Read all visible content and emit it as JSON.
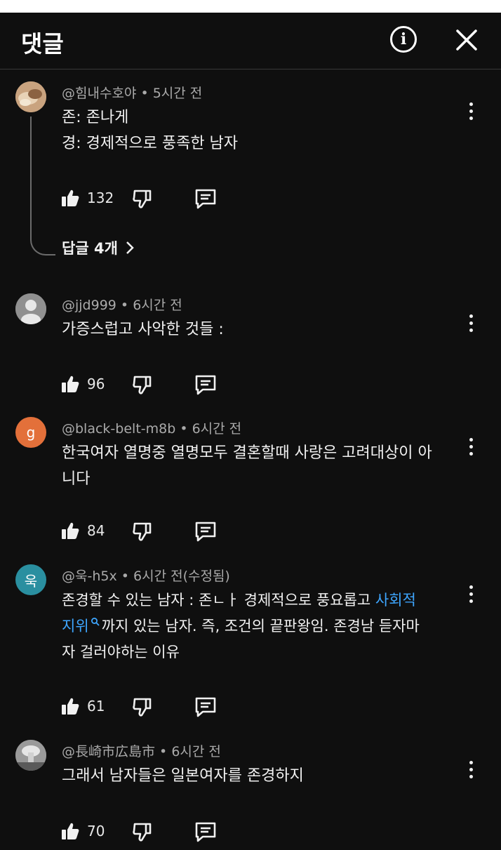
{
  "header": {
    "title": "댓글",
    "info_icon": "info-icon",
    "close_icon": "close-icon"
  },
  "comments": [
    {
      "author": "@힘내수호야",
      "time": "5시간 전",
      "avatar": {
        "type": "photo",
        "color": "#b99572"
      },
      "lines": [
        "존: 존나게",
        "경: 경제적으로 풍족한 남자"
      ],
      "likes": "132",
      "replies_label": "답글 4개"
    },
    {
      "author": "@jjd999",
      "time": "6시간 전",
      "avatar": {
        "type": "default",
        "color": "#909090"
      },
      "lines": [
        "가증스럽고 사악한 것들 :"
      ],
      "likes": "96"
    },
    {
      "author": "@black-belt-m8b",
      "time": "6시간 전",
      "avatar": {
        "type": "letter",
        "letter": "g",
        "color": "#e3703a"
      },
      "lines": [
        "한국여자 열명중 열명모두 결혼할때 사랑은 고려대상이 아",
        "니다"
      ],
      "likes": "84"
    },
    {
      "author": "@욱-h5x",
      "time": "6시간 전(수정됨)",
      "avatar": {
        "type": "letter",
        "letter": "욱",
        "color": "#2a8fa0"
      },
      "line1_pre": "존경할 수 있는 남자 : 존ㄴㅏ 경제적으로 풍요롭고 ",
      "line1_link": "사회적",
      "line2_link": "지위",
      "line2_post": "까지 있는 남자. 즉, 조건의 끝판왕임. 존경남 듣자마",
      "line3": "자 걸러야하는 이유",
      "likes": "61"
    },
    {
      "author": "@長崎市広島市",
      "time": "6시간 전",
      "avatar": {
        "type": "photo",
        "color": "#8a8a8a"
      },
      "lines": [
        "그래서 남자들은 일본여자를 존경하지"
      ],
      "likes": "70"
    }
  ]
}
